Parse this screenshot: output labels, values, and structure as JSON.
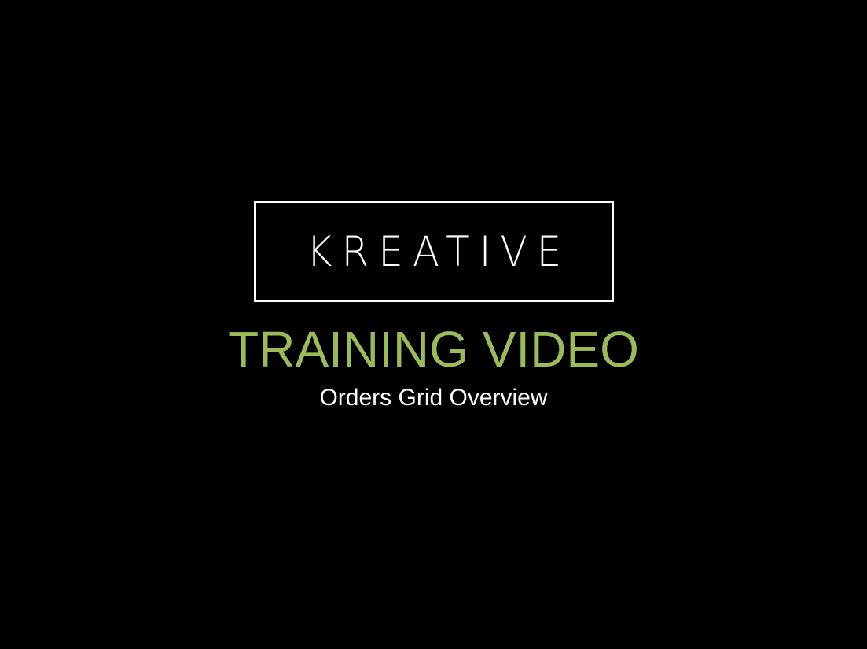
{
  "logo": {
    "text": "KREATIVE"
  },
  "title": "TRAINING VIDEO",
  "subtitle": "Orders Grid Overview",
  "colors": {
    "background": "#000000",
    "title": "#9bbb59",
    "text": "#ffffff"
  }
}
